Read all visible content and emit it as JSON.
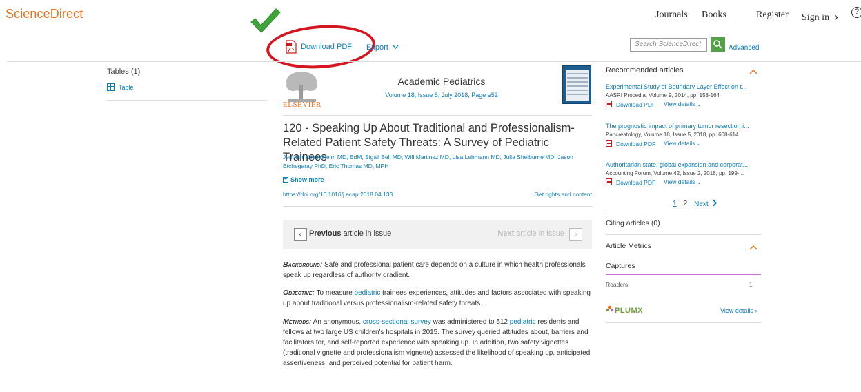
{
  "header": {
    "logo": "ScienceDirect",
    "nav": [
      "Journals",
      "Books",
      "Register",
      "Sign in"
    ],
    "sign_in_chevron": "›",
    "help": "?"
  },
  "toolbar": {
    "download_pdf": "Download PDF",
    "export": "Export",
    "search_placeholder": "Search ScienceDirect",
    "advanced": "Advanced"
  },
  "left": {
    "tables_heading": "Tables (1)",
    "table_link": "Table"
  },
  "journal": {
    "publisher": "ELSEVIER",
    "name": "Academic Pediatrics",
    "volume": "Volume 18, Issue 5, July 2018, Page e52"
  },
  "article": {
    "title": "120 - Speaking Up About Traditional and Professionalism-Related Patient Safety Threats: A Survey of Pediatric Trainees",
    "authors": "Jennifer Kesselheim MD, EdM, Sigall Bell MD, Will Martinez MD, Lisa Lehmann MD, Julia Shelburne MD, Jason Etchegaray PhD, Eric Thomas MD, MPH",
    "show_more": "Show more",
    "doi": "https://doi.org/10.1016/j.acap.2018.04.133",
    "rights": "Get rights and content"
  },
  "nav_issue": {
    "prev_bold": "Previous",
    "prev_rest": " article in issue",
    "next_bold": "Next",
    "next_rest": " article in issue"
  },
  "abstract": {
    "background_label": "Background:",
    "background_text": " Safe and professional patient care depends on a culture in which health professionals speak up regardless of authority gradient.",
    "objective_label": "Objective:",
    "objective_pre": " To measure ",
    "objective_link": "pediatric",
    "objective_post": " trainees experiences, attitudes and factors associated with speaking up about traditional versus professionalism-related safety threats.",
    "methods_label": "Methods:",
    "methods_pre": " An anonymous, ",
    "methods_link1": "cross-sectional survey",
    "methods_mid": " was administered to 512 ",
    "methods_link2": "pediatric",
    "methods_post": " residents and fellows at two large US children's hospitals in 2015. The survey queried attitudes about, barriers and facilitators for, and self-reported experience with speaking up. In addition, two safety vignettes (traditional vignette and professionalism vignette) assessed the likelihood of speaking up, anticipated assertiveness, and perceived potential for patient harm."
  },
  "sidebar": {
    "recommended_title": "Recommended articles",
    "recommended": [
      {
        "title": "Experimental Study of Boundary Layer Effect on t...",
        "source": "AASRI Procedia, Volume 9, 2014, pp. 158-164",
        "download": "Download PDF",
        "view": "View details"
      },
      {
        "title": "The prognostic impact of primary tumor resection i...",
        "source": "Pancreatology, Volume 18, Issue 5, 2018, pp. 608-614",
        "download": "Download PDF",
        "view": "View details"
      },
      {
        "title": "Authoritarian state, global expansion and corporat...",
        "source": "Accounting Forum, Volume 42, Issue 2, 2018, pp. 199-...",
        "download": "Download PDF",
        "view": "View details"
      }
    ],
    "pager": {
      "p1": "1",
      "p2": "2",
      "next": "Next"
    },
    "citing": "Citing articles (0)",
    "metrics_title": "Article Metrics",
    "captures": "Captures",
    "readers_label": "Readers:",
    "readers_value": "1",
    "plumx": "PLUMX",
    "plumx_view": "View details"
  }
}
